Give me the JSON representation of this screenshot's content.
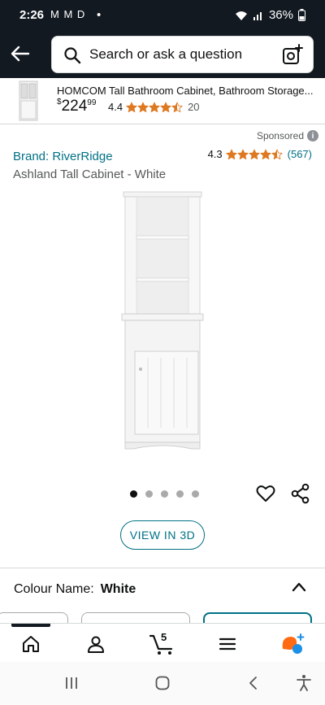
{
  "status_bar": {
    "time": "2:26",
    "notifications": "M M D",
    "battery": "36%"
  },
  "search": {
    "placeholder": "Search or ask a question"
  },
  "sticky_product": {
    "title": "HOMCOM Tall Bathroom Cabinet, Bathroom Storage...",
    "price_currency": "$",
    "price_whole": "224",
    "price_fraction": "99",
    "rating": "4.4",
    "review_count": "20",
    "stars_value": 4.5
  },
  "sponsored_label": "Sponsored",
  "product": {
    "brand": "Brand: RiverRidge",
    "rating": "4.3",
    "stars_value": 4.5,
    "review_count": "(567)",
    "title": "Ashland Tall Cabinet - White",
    "image_count": 5,
    "active_image_index": 0
  },
  "view_3d_label": "VIEW IN 3D",
  "colour": {
    "label": "Colour Name:",
    "value": "White"
  },
  "bottom_nav": {
    "cart_count": "5",
    "items": [
      "home-icon",
      "account-icon",
      "cart-icon",
      "menu-icon",
      "rufus-icon"
    ]
  },
  "colors": {
    "header_bg": "#131921",
    "link": "#007185",
    "star": "#de7921"
  }
}
